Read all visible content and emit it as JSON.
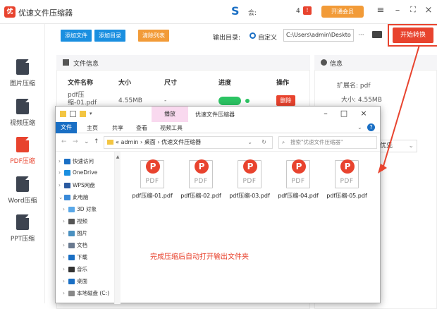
{
  "app": {
    "title": "优速文件压缩器",
    "logo_text": "优",
    "brand_mark": "S",
    "user_label": "会:",
    "notify_count": "4",
    "vip_label": "开通会员",
    "menu_glyph": "≡",
    "min_glyph": "–",
    "max_glyph": "⛶",
    "close_glyph": "×"
  },
  "sidebar": {
    "items": [
      {
        "label": "图片压缩",
        "badge": "IMG"
      },
      {
        "label": "视频压缩",
        "badge": "VID"
      },
      {
        "label": "PDF压缩",
        "badge": "PDF"
      },
      {
        "label": "Word压缩",
        "badge": "DOC"
      },
      {
        "label": "PPT压缩",
        "badge": "PPT"
      }
    ],
    "active_index": 2
  },
  "toolbar": {
    "add_file": "添加文件",
    "add_dir": "添加目录",
    "clear_list": "清除列表",
    "output_label": "输出目录:",
    "output_mode": "自定义",
    "output_path": "C:\\Users\\admin\\Deskto",
    "more": "···",
    "start": "开始转换"
  },
  "file_panel": {
    "title": "文件信息",
    "columns": [
      "文件名称",
      "大小",
      "尺寸",
      "进度",
      "操作"
    ],
    "row": {
      "name": "pdf压缩-01.pdf",
      "size": "4.55MB",
      "dim": "-",
      "delete": "删除"
    }
  },
  "info_panel": {
    "title": "信息",
    "ext": "扩展名:  pdf",
    "size": "大小:  4.55MB",
    "select_value": "优先"
  },
  "explorer": {
    "ctx_tab": "播放",
    "title": "优速文件压缩器",
    "ribbon": [
      "文件",
      "主页",
      "共享",
      "查看",
      "视频工具"
    ],
    "address": "« admin › 桌面 › 优速文件压缩器",
    "search_placeholder": "搜索\"优速文件压缩器\"",
    "nav": [
      {
        "label": "快速访问",
        "chev": "›",
        "color": "#1a6fc4"
      },
      {
        "label": "OneDrive",
        "chev": "›",
        "color": "#1a8fe0"
      },
      {
        "label": "WPS网盘",
        "chev": "›",
        "color": "#2a5aa0"
      },
      {
        "label": "此电脑",
        "chev": "⌄",
        "color": "#3a8ad8"
      },
      {
        "label": "3D 对象",
        "chev": "›",
        "color": "#5aa8e8"
      },
      {
        "label": "视频",
        "chev": "›",
        "color": "#555"
      },
      {
        "label": "图片",
        "chev": "›",
        "color": "#4a90c0"
      },
      {
        "label": "文档",
        "chev": "›",
        "color": "#6a7a90"
      },
      {
        "label": "下载",
        "chev": "›",
        "color": "#1a6fc4"
      },
      {
        "label": "音乐",
        "chev": "›",
        "color": "#333"
      },
      {
        "label": "桌面",
        "chev": "›",
        "color": "#1a6fc4"
      },
      {
        "label": "本地磁盘 (C:)",
        "chev": "›",
        "color": "#888"
      }
    ],
    "files": [
      "pdf压缩-01.pdf",
      "pdf压缩-02.pdf",
      "pdf压缩-03.pdf",
      "pdf压缩-04.pdf",
      "pdf压缩-05.pdf"
    ],
    "file_badge": "P",
    "file_word": "PDF",
    "note": "完成压缩后自动打开输出文件夹"
  },
  "colors": {
    "accent": "#e8432e",
    "blue": "#1a6fc4",
    "orange": "#f29b38",
    "green": "#2cc463"
  }
}
